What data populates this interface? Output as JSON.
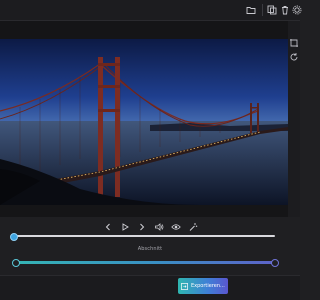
{
  "toolbar": {
    "icons": [
      "folder-icon",
      "duplicate-icon",
      "delete-icon",
      "settings-icon"
    ]
  },
  "preview": {
    "image": "golden-gate-bridge-at-dusk"
  },
  "playback": {
    "controls": [
      "previous-frame-icon",
      "play-icon",
      "next-frame-icon",
      "volume-icon",
      "eye-icon",
      "magic-wand-icon"
    ],
    "position": 0.0
  },
  "trim": {
    "label": "Abschnitt",
    "start": 0.0,
    "end": 1.0
  },
  "footer": {
    "export_label": "Exportieren..."
  },
  "colors": {
    "accent_start": "#2fb6b0",
    "accent_end": "#5a56cf",
    "background": "#1f1f22"
  }
}
